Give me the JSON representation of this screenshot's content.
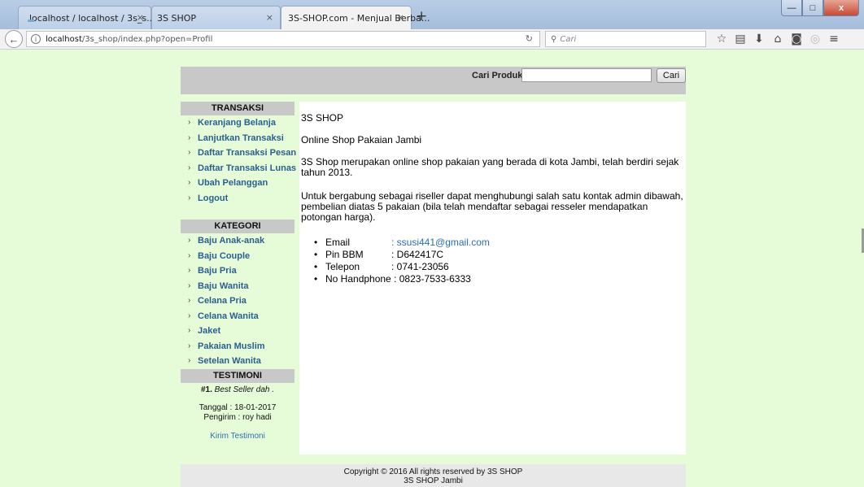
{
  "browser": {
    "tabs": [
      {
        "title": "localhost / localhost / 3s_s...",
        "close": "×"
      },
      {
        "title": "3S SHOP",
        "close": "×"
      },
      {
        "title": "3S-SHOP.com - Menjual Berba...",
        "close": "×"
      }
    ],
    "new_tab": "+",
    "url_host": "localhost",
    "url_path": "/3s_shop/index.php?open=Profil",
    "search_placeholder": "Cari",
    "window_controls": {
      "minimize": "—",
      "maximize": "□",
      "close": "x"
    }
  },
  "header": {
    "search_label": "Cari Produk",
    "search_value": "",
    "search_button": "Cari"
  },
  "sidebar": {
    "transaksi_title": "TRANSAKSI",
    "transaksi_items": [
      "Keranjang Belanja",
      "Lanjutkan Transaksi",
      "Daftar Transaksi Pesan",
      "Daftar Transaksi Lunas",
      "Ubah Pelanggan",
      "Logout"
    ],
    "kategori_title": "KATEGORI",
    "kategori_items": [
      "Baju Anak-anak",
      "Baju Couple",
      "Baju Pria",
      "Baju Wanita",
      "Celana Pria",
      "Celana Wanita",
      "Jaket",
      "Pakaian Muslim",
      "Setelan Wanita"
    ],
    "testimoni_title": "TESTIMONI",
    "testimoni_number": "#1.",
    "testimoni_text": "Best Seller dah .",
    "testimoni_date": "Tanggal : 18-01-2017",
    "testimoni_sender": "Pengirim : roy hadi",
    "testimoni_link": "Kirim Testimoni"
  },
  "content": {
    "shop_title": "3S SHOP",
    "subtitle": "Online Shop Pakaian Jambi",
    "para1": "3S Shop merupakan online shop pakaian yang berada di kota Jambi, telah berdiri sejak tahun 2013.",
    "para2": "Untuk bergabung sebagai riseller dapat menghubungi salah satu kontak admin dibawah, pembelian diatas 5 pakaian (bila telah mendaftar sebagai resseler mendapatkan potongan harga).",
    "contacts": [
      {
        "label": "Email",
        "value": ": ssusi441@gmail.com"
      },
      {
        "label": "Pin BBM",
        "value": ": D642417C"
      },
      {
        "label": "Telepon",
        "value": ": 0741-23056"
      },
      {
        "label": "No Handphone",
        "value": ": 0823-7533-6333"
      }
    ]
  },
  "footer": {
    "line1": "Copyright © 2016 All rights reserved by 3S SHOP",
    "line2": "3S SHOP Jambi"
  }
}
